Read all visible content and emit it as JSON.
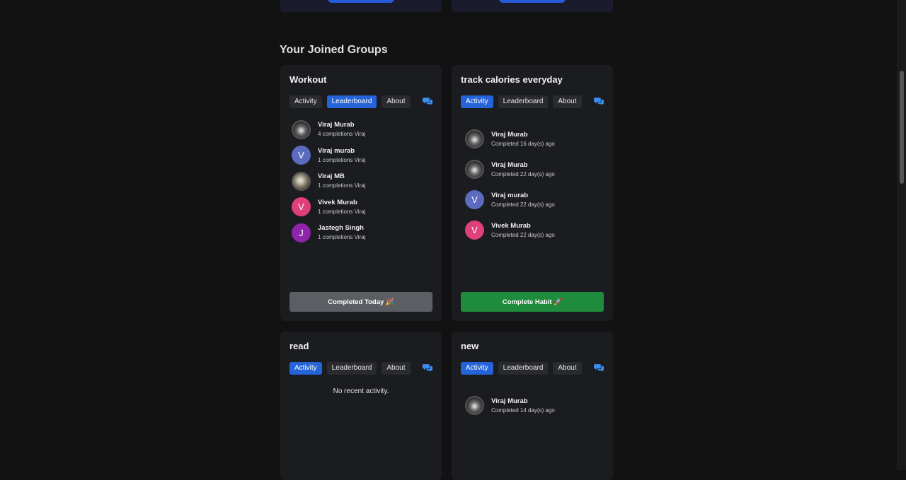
{
  "section_title": "Your Joined Groups",
  "tab_labels": {
    "activity": "Activity",
    "leaderboard": "Leaderboard",
    "about": "About"
  },
  "groups": [
    {
      "title": "Workout",
      "active_tab": "Leaderboard",
      "leaderboard": [
        {
          "name": "Viraj Murab",
          "sub": "4 completions Viraj",
          "avatar": "photo"
        },
        {
          "name": "Viraj murab",
          "sub": "1 completions Viraj",
          "avatar": "V",
          "color": "#5c6bc0"
        },
        {
          "name": "Viraj MB",
          "sub": "1 completions Viraj",
          "avatar": "photo2"
        },
        {
          "name": "Vivek Murab",
          "sub": "1 completions Viraj",
          "avatar": "V",
          "color": "#e0407a"
        },
        {
          "name": "Jastegh Singh",
          "sub": "1 completions Viraj",
          "avatar": "J",
          "color": "#8e24aa"
        }
      ],
      "button_label": "Completed Today 🎉"
    },
    {
      "title": "track calories everyday",
      "active_tab": "Activity",
      "activity": [
        {
          "name": "Viraj Murab",
          "sub": "Completed 16 day(s) ago",
          "avatar": "photo"
        },
        {
          "name": "Viraj Murab",
          "sub": "Completed 22 day(s) ago",
          "avatar": "photo"
        },
        {
          "name": "Viraj murab",
          "sub": "Completed 22 day(s) ago",
          "avatar": "V",
          "color": "#5c6bc0"
        },
        {
          "name": "Vivek Murab",
          "sub": "Completed 22 day(s) ago",
          "avatar": "V",
          "color": "#e0407a"
        }
      ],
      "button_label": "Complete Habit 🚀"
    },
    {
      "title": "read",
      "active_tab": "Activity",
      "empty_text": "No recent activity."
    },
    {
      "title": "new",
      "active_tab": "Activity",
      "activity": [
        {
          "name": "Viraj Murab",
          "sub": "Completed 14 day(s) ago",
          "avatar": "photo"
        }
      ]
    }
  ],
  "colors": {
    "accent": "#2563d9",
    "success": "#1f8b3c",
    "chat_icon": "#3b8ef0",
    "background": "#121212",
    "card": "#1b1c1f"
  },
  "icons": {
    "chat": "chat-bubbles-icon"
  }
}
